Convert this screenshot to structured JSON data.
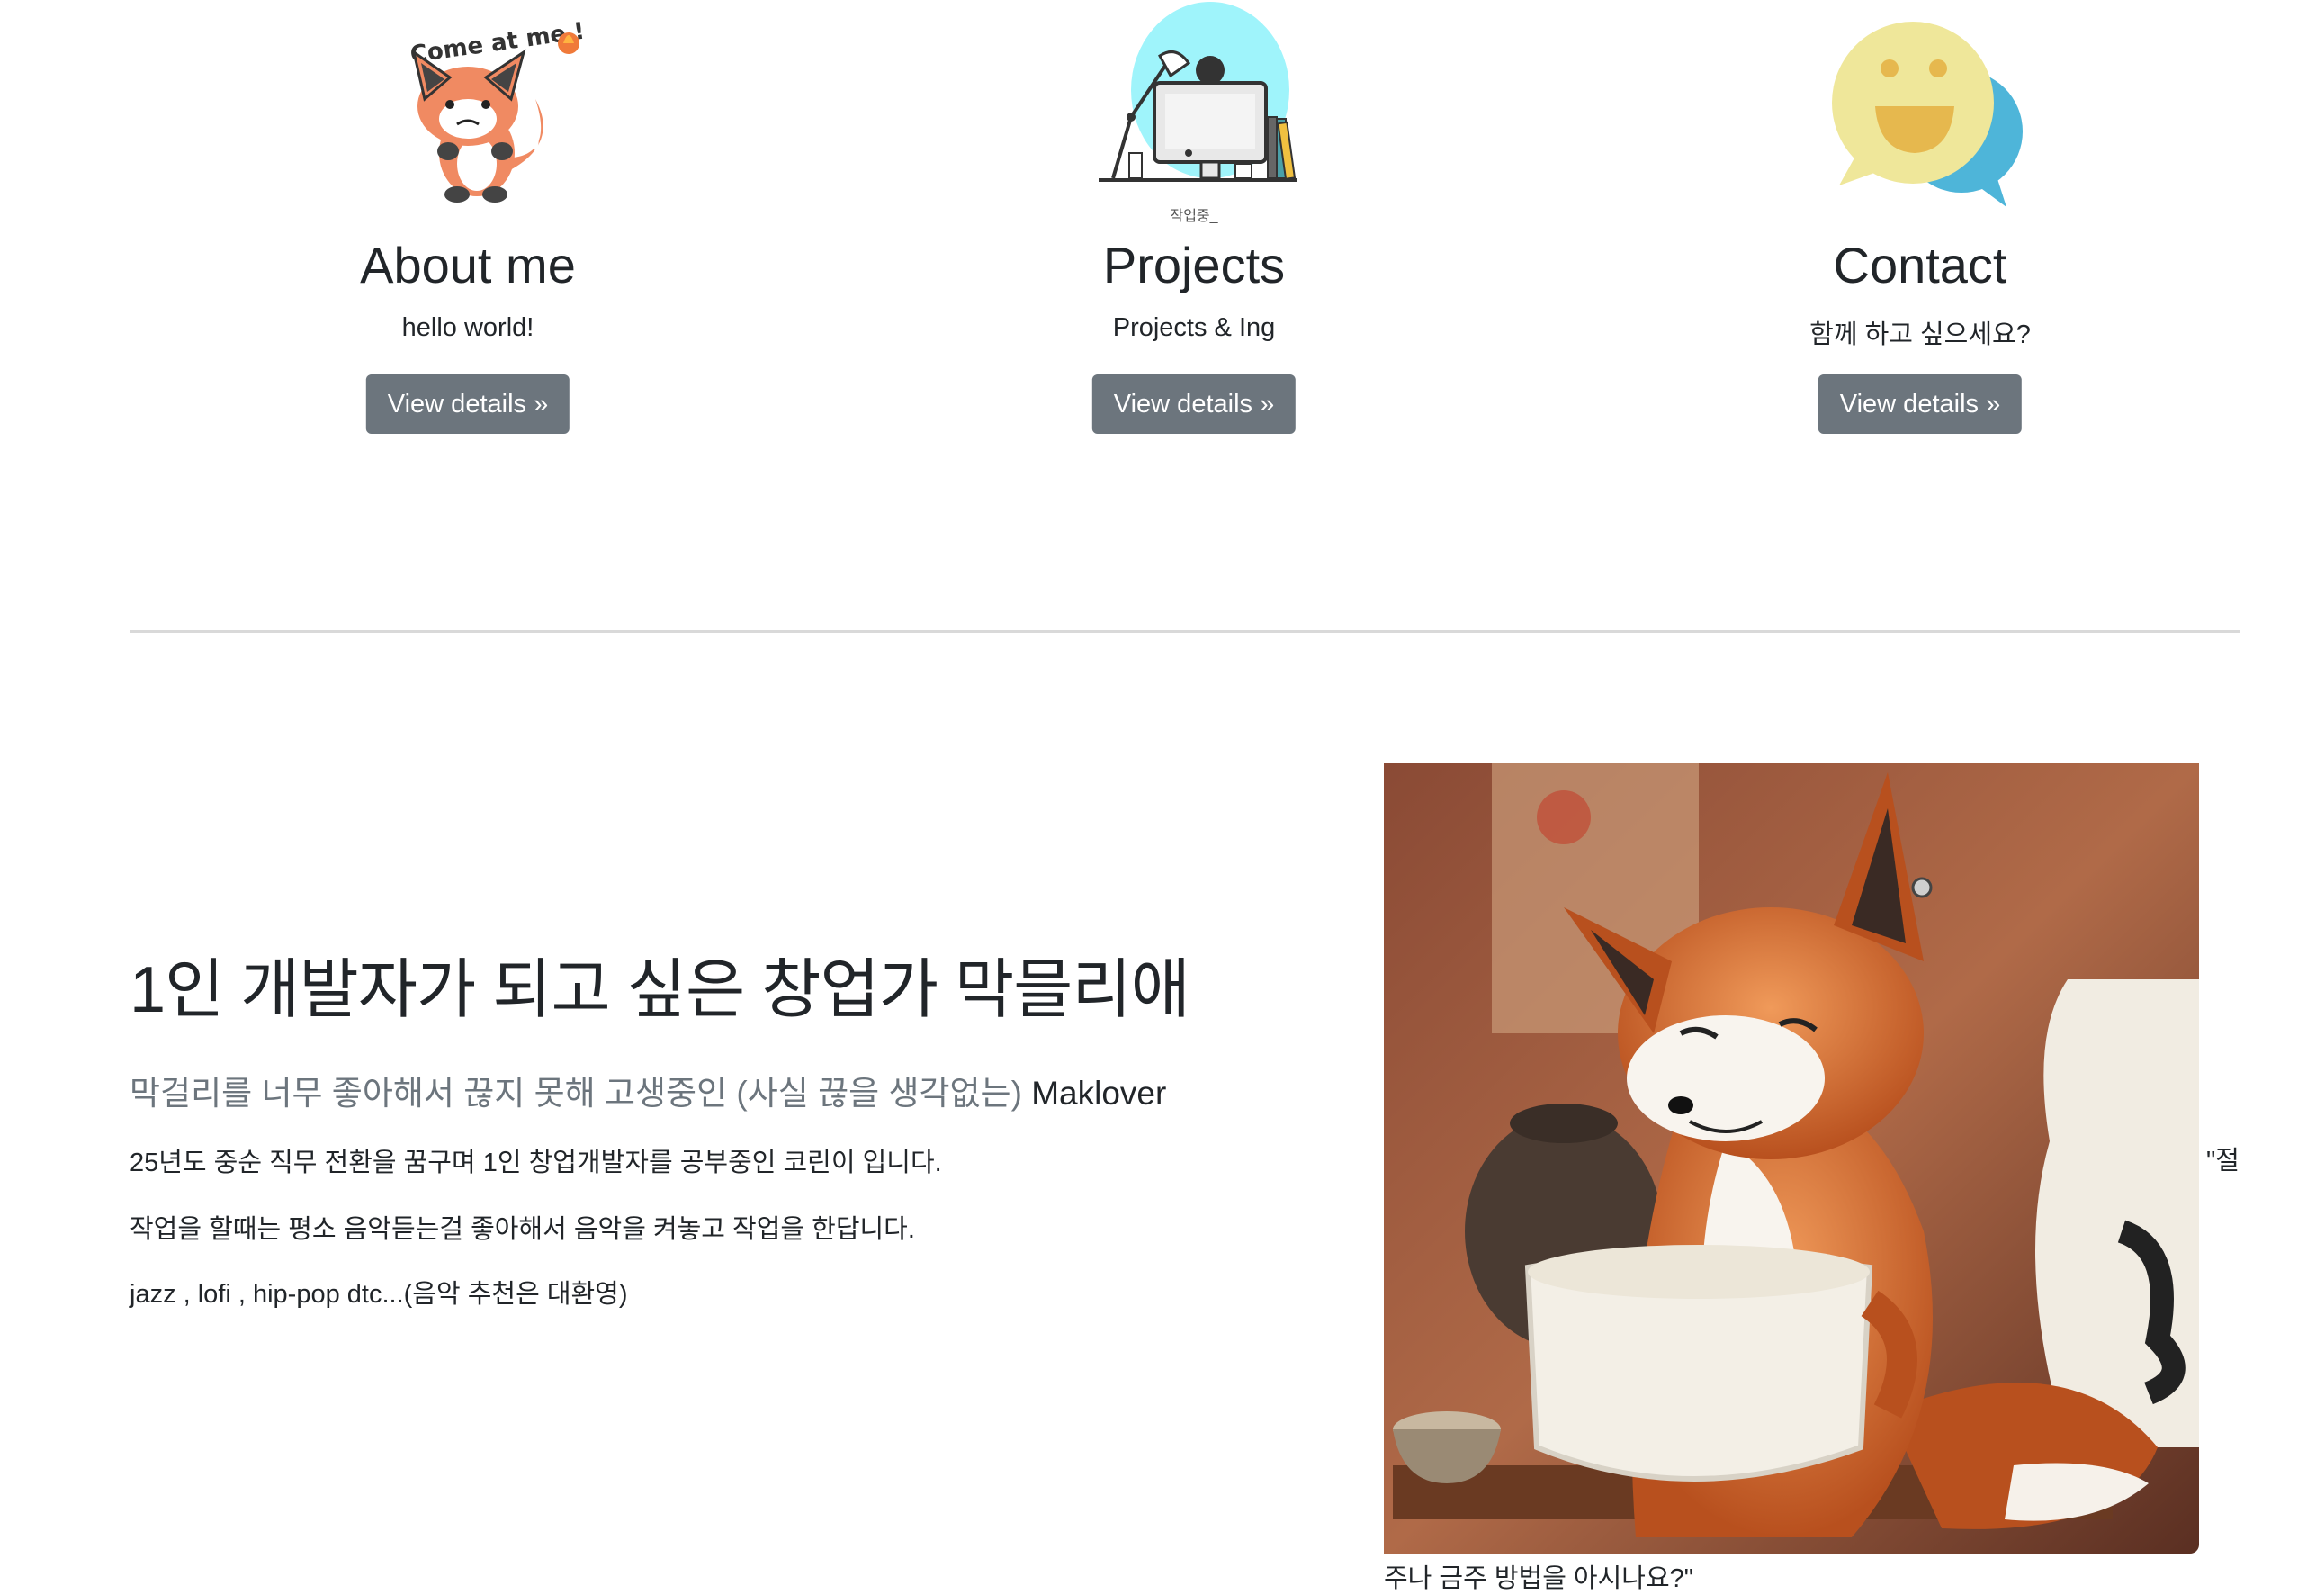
{
  "cards": [
    {
      "title": "About me",
      "text": "hello world!",
      "button": "View details »",
      "sticker": "Come at me !"
    },
    {
      "title": "Projects",
      "text": "Projects & Ing",
      "button": "View details »",
      "caption": "작업중_"
    },
    {
      "title": "Contact",
      "text": "함께 하고 싶으세요?",
      "button": "View details »"
    }
  ],
  "feature": {
    "heading": "1인 개발자가 되고 싶은 창업가 막믈리애",
    "lead_ko": "막걸리를 너무 좋아해서 끊지 못해 고생중인 (사실 끊을 생각없는) ",
    "lead_en": "Maklover",
    "p1": "25년도 중순 직무 전환을 꿈구며 1인 창업개발자를 공부중인 코린이 입니다.",
    "p2": "작업을 할때는 평소 음악듣는걸 좋아해서 음악을 켜놓고 작업을 한답니다.",
    "p3": "jazz , lofi , hip-pop dtc...(음악 추천은 대환영)",
    "quote_start": "\"절",
    "quote_end": "주나 금주 방법을 아시나요?\""
  },
  "icons": [
    "fox-sticker-icon",
    "desk-workstation-icon",
    "chat-bubble-smile-icon"
  ],
  "colors": {
    "button": "#6c757d",
    "divider": "#d9d9d9",
    "fox": "#e07a50"
  }
}
